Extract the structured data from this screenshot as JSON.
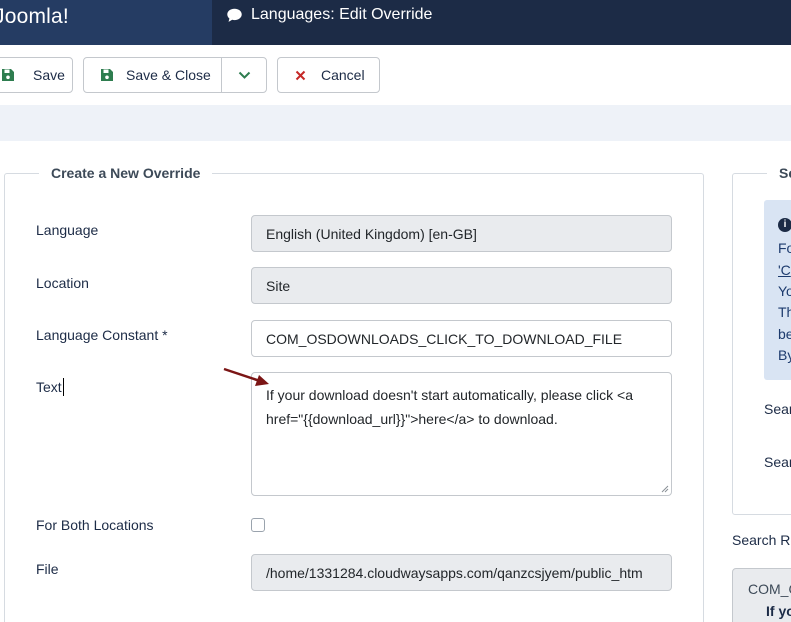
{
  "header": {
    "brand": "Joomla!",
    "title": "Languages: Edit Override"
  },
  "toolbar": {
    "save_label": "Save",
    "save_close_label": "Save & Close",
    "cancel_label": "Cancel"
  },
  "form": {
    "legend": "Create a New Override",
    "language_label": "Language",
    "language_value": "English (United Kingdom) [en-GB]",
    "location_label": "Location",
    "location_value": "Site",
    "constant_label": "Language Constant *",
    "constant_value": "COM_OSDOWNLOADS_CLICK_TO_DOWNLOAD_FILE",
    "text_label": "Text",
    "text_line1": "If your download doesn't start automatically, please click <a",
    "text_line2": "href=\"{{download_url}}\">here</a> to download.",
    "both_locations_label": "For Both Locations",
    "file_label": "File",
    "file_value": "/home/1331284.cloudwaysapps.com/qanzcsjyem/public_htm"
  },
  "search_panel": {
    "legend": "Se",
    "info_lines": [
      "Fo",
      "'C",
      "Yo",
      "Th",
      "be",
      "By"
    ],
    "search_label_1": "Sear",
    "search_label_2": "Sear",
    "results_label": "Search Re",
    "result_constant": "COM_O",
    "result_text": "If yo"
  },
  "colors": {
    "topbar": "#1c2b46",
    "brand_bg": "#253c63",
    "save_icon": "#2e7d4f",
    "cancel_icon": "#c52827",
    "arrow": "#7b1515"
  }
}
